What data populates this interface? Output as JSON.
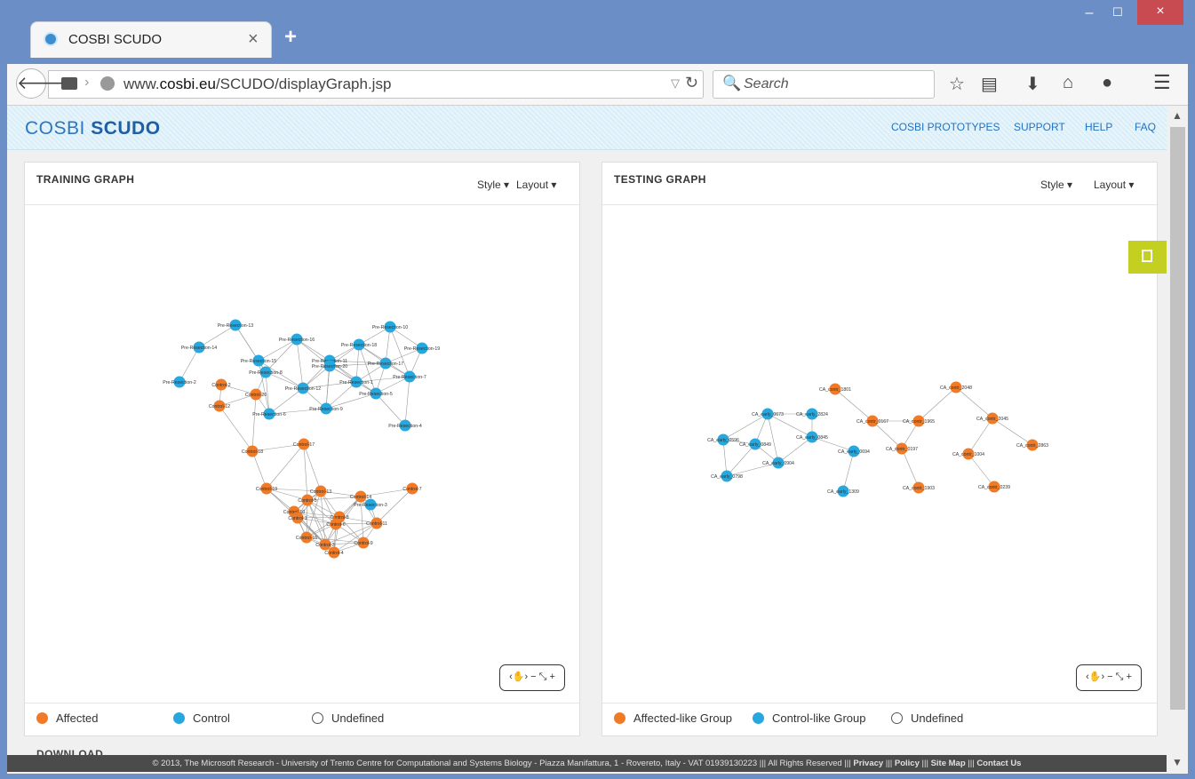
{
  "browser": {
    "tab_title": "COSBI SCUDO",
    "tab_close": "×",
    "new_tab": "+",
    "url_prefix": "www.",
    "url_domain": "cosbi.eu",
    "url_path": "/SCUDO/displayGraph.jsp",
    "search_placeholder": "Search",
    "window_buttons": {
      "minimize": "–",
      "maximize": "☐",
      "close": "×"
    }
  },
  "site": {
    "logo_light": "COSBI ",
    "logo_bold": "SCUDO",
    "nav": [
      "COSBI PROTOTYPES",
      "SUPPORT",
      "HELP",
      "FAQ"
    ]
  },
  "training_panel": {
    "title": "TRAINING GRAPH",
    "style_label": "Style",
    "layout_label": "Layout",
    "legend": [
      {
        "label": "Affected",
        "color": "#f07a25"
      },
      {
        "label": "Control",
        "color": "#26a7de"
      },
      {
        "label": "Undefined",
        "color": "#ffffff"
      }
    ]
  },
  "testing_panel": {
    "title": "TESTING GRAPH",
    "style_label": "Style",
    "layout_label": "Layout",
    "legend": [
      {
        "label": "Affected-like Group",
        "color": "#f07a25"
      },
      {
        "label": "Control-like Group",
        "color": "#26a7de"
      },
      {
        "label": "Undefined",
        "color": "#ffffff"
      }
    ]
  },
  "colors": {
    "affected": "#f07a25",
    "control": "#26a7de",
    "edge": "#9a9a9a",
    "accent_tab": "#c3d021"
  },
  "download_heading": "DOWNLOAD",
  "footer": {
    "text": "© 2013, The Microsoft Research - University of Trento Centre for Computational and Systems Biology - Piazza Manifattura, 1 - Rovereto, Italy - VAT 01939130223 ||| All Rights Reserved ||| ",
    "links": [
      "Privacy",
      "Policy",
      "Site Map",
      "Contact Us"
    ]
  },
  "training_graph": {
    "nodes": [
      {
        "id": "Pre-Resection-13",
        "g": "c"
      },
      {
        "id": "Pre-Resection-14",
        "g": "c"
      },
      {
        "id": "Pre-Resection-16",
        "g": "c"
      },
      {
        "id": "Pre-Resection-10",
        "g": "c"
      },
      {
        "id": "Pre-Resection-18",
        "g": "c"
      },
      {
        "id": "Pre-Resection-19",
        "g": "c"
      },
      {
        "id": "Pre-Resection-15",
        "g": "c"
      },
      {
        "id": "Pre-Resection-11",
        "g": "c"
      },
      {
        "id": "Pre-Resection-20",
        "g": "c"
      },
      {
        "id": "Pre-Resection-17",
        "g": "c"
      },
      {
        "id": "Pre-Resection-8",
        "g": "c"
      },
      {
        "id": "Pre-Resection-7",
        "g": "c"
      },
      {
        "id": "Pre-Resection-2",
        "g": "c"
      },
      {
        "id": "Pre-Resection-1",
        "g": "c"
      },
      {
        "id": "Pre-Resection-12",
        "g": "c"
      },
      {
        "id": "Pre-Resection-5",
        "g": "c"
      },
      {
        "id": "Pre-Resection-9",
        "g": "c"
      },
      {
        "id": "Pre-Resection-6",
        "g": "c"
      },
      {
        "id": "Pre-Resection-4",
        "g": "c"
      },
      {
        "id": "Pre-Resection-3",
        "g": "c"
      },
      {
        "id": "Control-2",
        "g": "a"
      },
      {
        "id": "Control-20",
        "g": "a"
      },
      {
        "id": "Control-12",
        "g": "a"
      },
      {
        "id": "Control-17",
        "g": "a"
      },
      {
        "id": "Control-18",
        "g": "a"
      },
      {
        "id": "Control-19",
        "g": "a"
      },
      {
        "id": "Control-13",
        "g": "a"
      },
      {
        "id": "Control-5",
        "g": "a"
      },
      {
        "id": "Control-14",
        "g": "a"
      },
      {
        "id": "Control-7",
        "g": "a"
      },
      {
        "id": "Control-10",
        "g": "a"
      },
      {
        "id": "Control-1",
        "g": "a"
      },
      {
        "id": "Control-8",
        "g": "a"
      },
      {
        "id": "Control-6",
        "g": "a"
      },
      {
        "id": "Control-11",
        "g": "a"
      },
      {
        "id": "Control-15",
        "g": "a"
      },
      {
        "id": "Control-3",
        "g": "a"
      },
      {
        "id": "Control-9",
        "g": "a"
      },
      {
        "id": "Control-4",
        "g": "a"
      }
    ]
  },
  "testing_graph": {
    "nodes": [
      {
        "id": "CA_contr_1801",
        "g": "a"
      },
      {
        "id": "CA_contr_2048",
        "g": "a"
      },
      {
        "id": "CA_early_0673",
        "g": "c"
      },
      {
        "id": "CA_early_2824",
        "g": "c"
      },
      {
        "id": "CA_contr_0167",
        "g": "a"
      },
      {
        "id": "CA_contr_1965",
        "g": "a"
      },
      {
        "id": "CA_contr_2045",
        "g": "a"
      },
      {
        "id": "CA_early_0596",
        "g": "c"
      },
      {
        "id": "CA_early_0849",
        "g": "c"
      },
      {
        "id": "CA_early_0845",
        "g": "c"
      },
      {
        "id": "CA_early_0694",
        "g": "c"
      },
      {
        "id": "CA_contr_0197",
        "g": "a"
      },
      {
        "id": "CA_contr_1004",
        "g": "a"
      },
      {
        "id": "CA_contr_2863",
        "g": "a"
      },
      {
        "id": "CA_early_0904",
        "g": "c"
      },
      {
        "id": "CA_early_0798",
        "g": "c"
      },
      {
        "id": "CA_early_1309",
        "g": "c"
      },
      {
        "id": "CA_contr_1903",
        "g": "a"
      },
      {
        "id": "CA_contr_0239",
        "g": "a"
      }
    ]
  }
}
